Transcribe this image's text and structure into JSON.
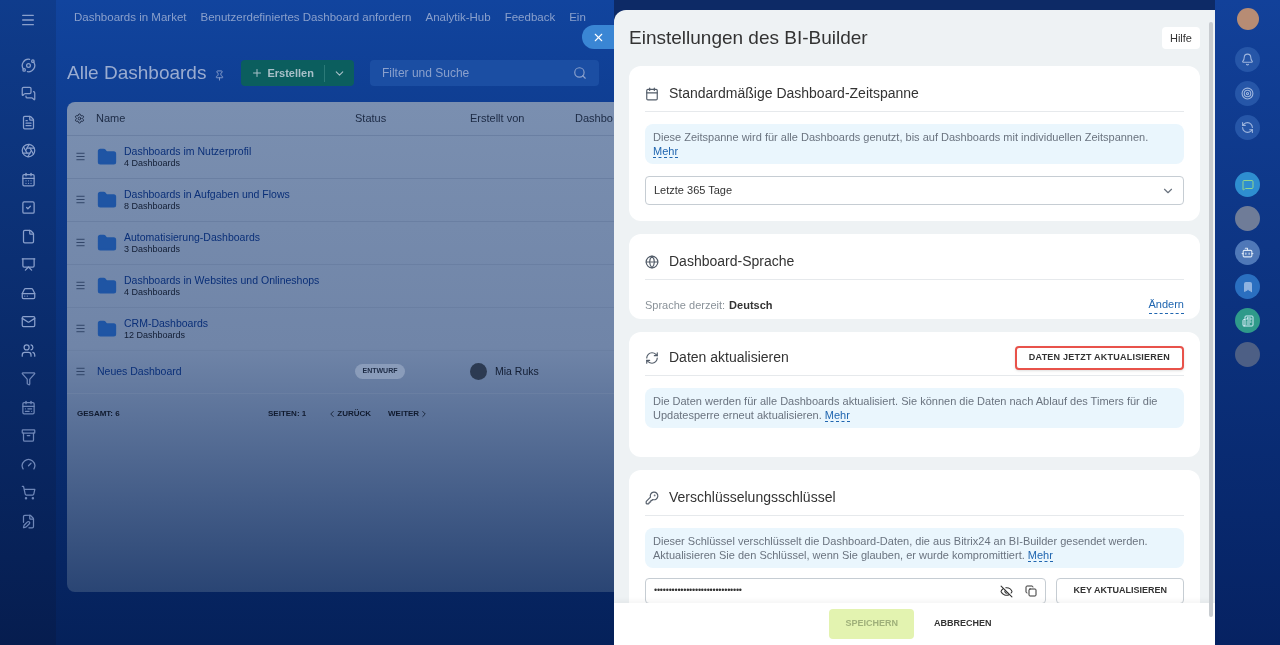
{
  "nav": {
    "items": [
      "Dashboards in Market",
      "Benutzerdefiniertes Dashboard anfordern",
      "Analytik-Hub",
      "Feedback",
      "Ein"
    ]
  },
  "page": {
    "title": "Alle Dashboards",
    "create_button": "Erstellen",
    "search": {
      "placeholder": "Filter und Suche"
    }
  },
  "table": {
    "columns": [
      "Name",
      "Status",
      "Erstellt von",
      "Dashbo"
    ],
    "rows": [
      {
        "kind": "folder",
        "name": "Dashboards im Nutzerprofil",
        "count": "4 Dashboards"
      },
      {
        "kind": "folder",
        "name": "Dashboards in Aufgaben und Flows",
        "count": "8 Dashboards"
      },
      {
        "kind": "folder",
        "name": "Automatisierung-Dashboards",
        "count": "3 Dashboards"
      },
      {
        "kind": "folder",
        "name": "Dashboards in Websites und Onlineshops",
        "count": "4 Dashboards"
      },
      {
        "kind": "folder",
        "name": "CRM-Dashboards",
        "count": "12 Dashboards"
      },
      {
        "kind": "dashboard",
        "name": "Neues Dashboard",
        "status": "ENTWURF",
        "author": "Mia Ruks"
      }
    ],
    "footer": {
      "total_label": "GESAMT:",
      "total": "6",
      "pages_label": "SEITEN:",
      "pages": "1",
      "prev": "ZURÜCK",
      "next": "WEITER"
    }
  },
  "panel": {
    "title": "Einstellungen des BI-Builder",
    "help_button": "Hilfe",
    "sections": [
      {
        "kind": "period",
        "title": "Standardmäßige Dashboard-Zeitspanne",
        "info": "Diese Zeitspanne wird für alle Dashboards genutzt, bis auf Dashboards mit individuellen Zeitspannen.",
        "link": "Mehr",
        "select": "Letzte 365 Tage"
      },
      {
        "kind": "language",
        "title": "Dashboard-Sprache",
        "label": "Sprache derzeit:",
        "value": "Deutsch",
        "link": "Ändern"
      },
      {
        "kind": "refresh",
        "title": "Daten aktualisieren",
        "button": {
          "label": "DATEN JETZT AKTUALISIEREN",
          "highlighted": true
        },
        "info": "Die Daten werden für alle Dashboards aktualisiert. Sie können die Daten nach Ablauf des Timers für die Updatesperre erneut aktualisieren.",
        "link": "Mehr"
      },
      {
        "kind": "key",
        "title": "Verschlüsselungsschlüssel",
        "info": "Dieser Schlüssel verschlüsselt die Dashboard-Daten, die aus Bitrix24 an BI-Builder gesendet werden. Aktualisieren Sie den Schlüssel, wenn Sie glauben, er wurde kompromittiert.",
        "link": "Mehr",
        "key_value": "••••••••••••••••••••••••••••••",
        "button": "KEY AKTUALISIEREN"
      }
    ],
    "footer": {
      "save": {
        "label": "SPEICHERN",
        "disabled": true
      },
      "cancel": "ABBRECHEN"
    }
  }
}
